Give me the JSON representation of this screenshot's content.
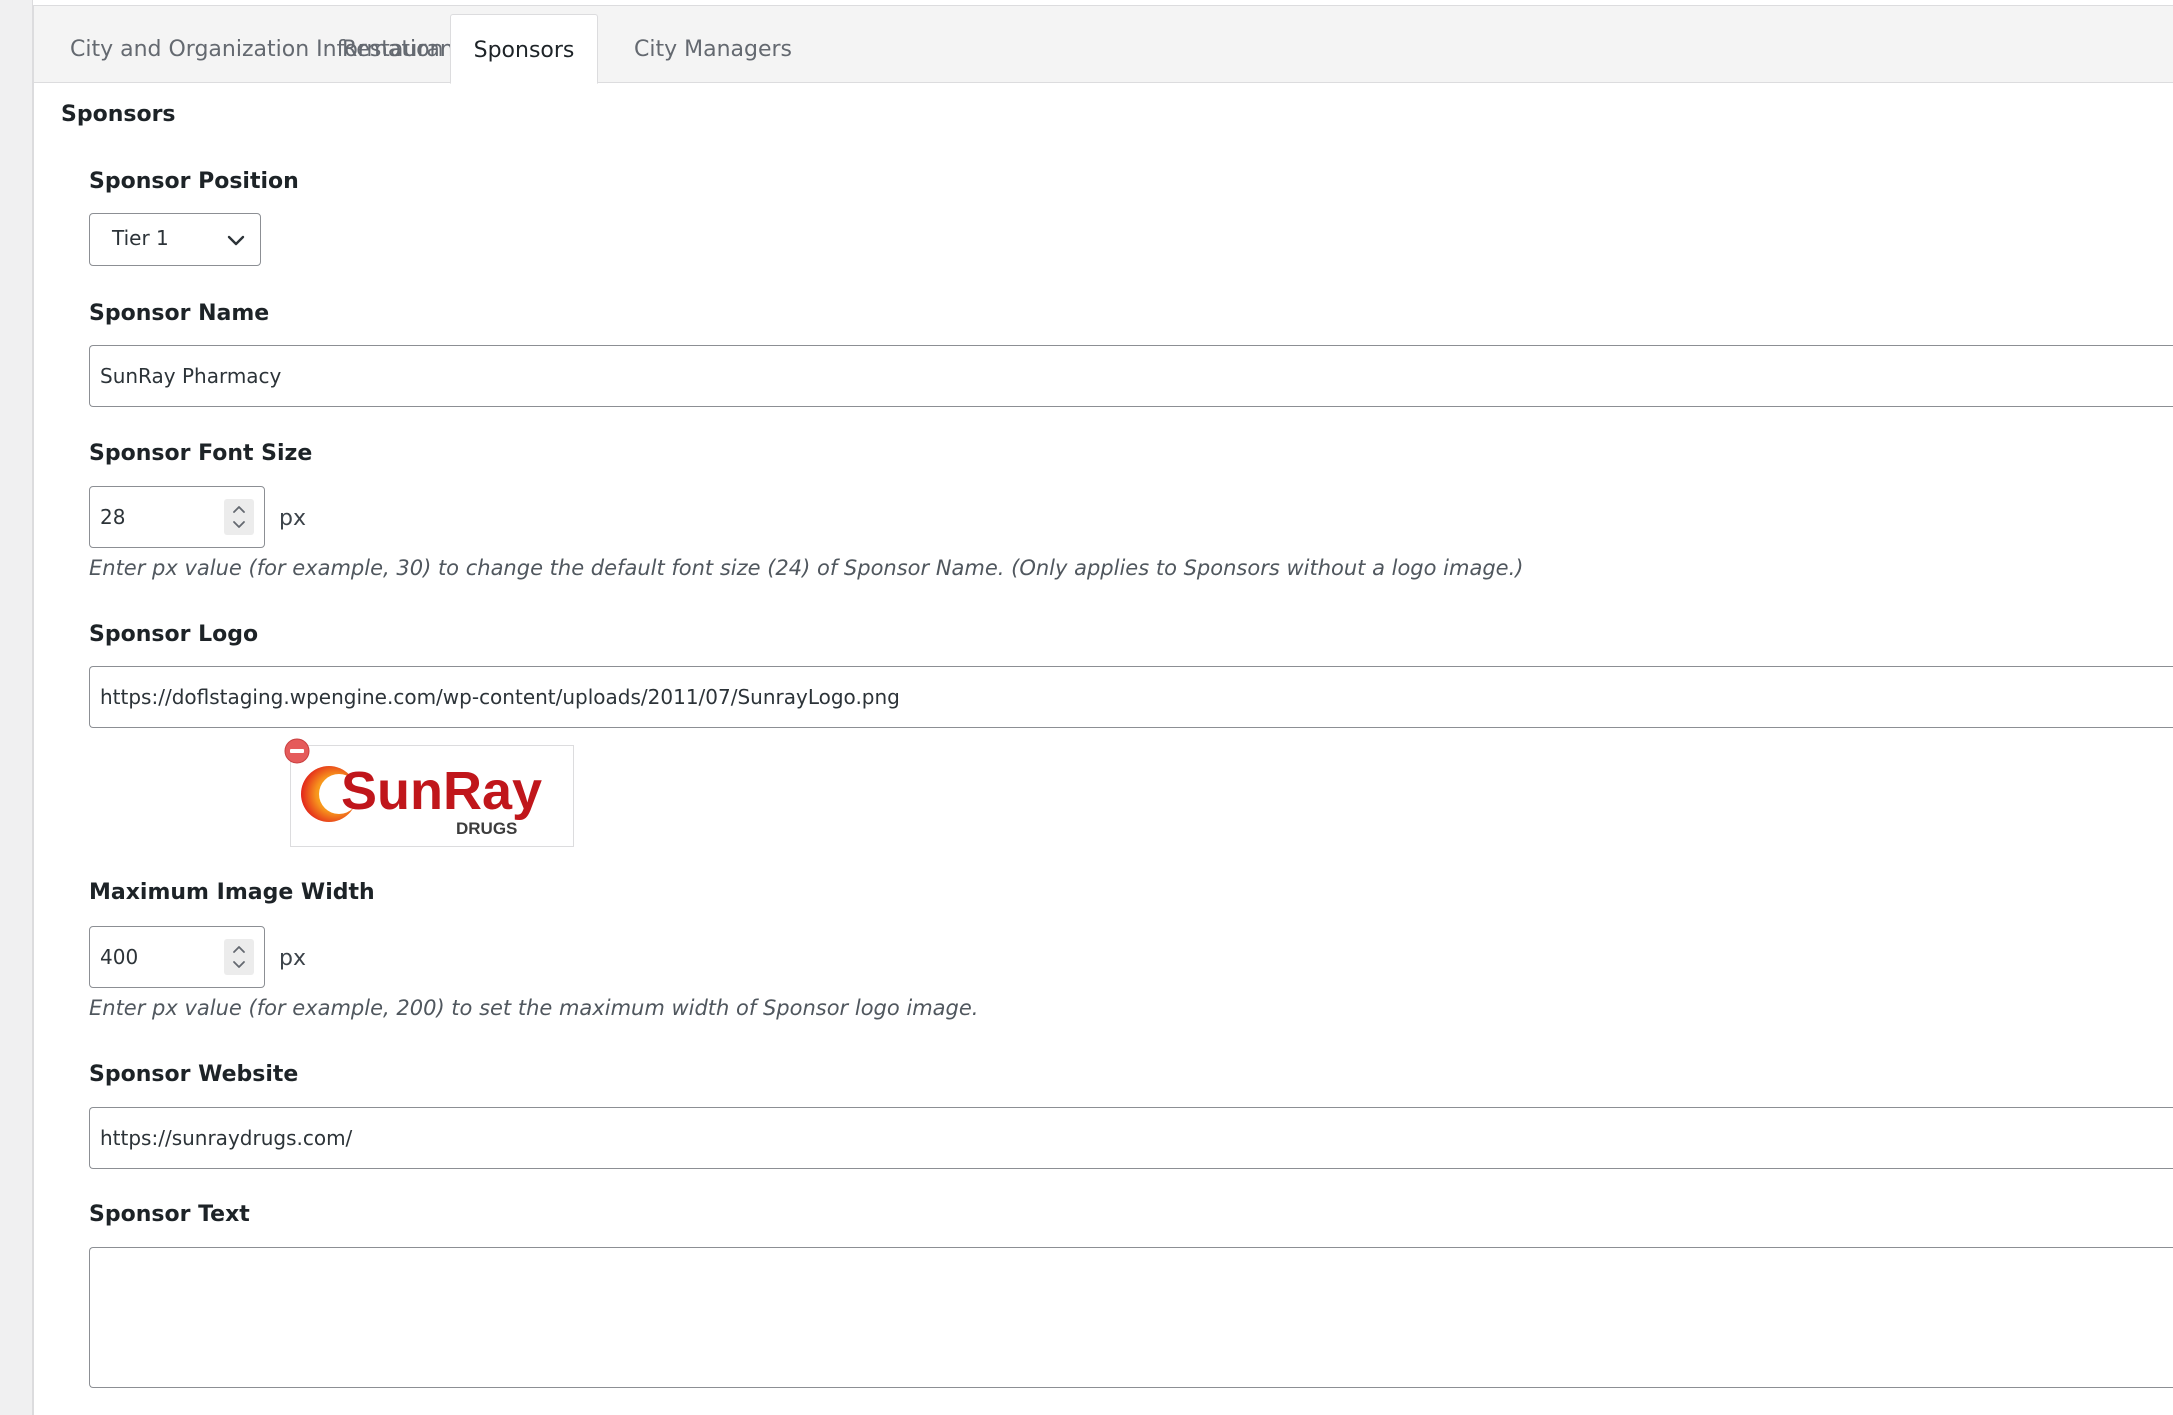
{
  "tabs": [
    {
      "label": "City and Organization Information",
      "active": false
    },
    {
      "label": "Restaurants",
      "active": false
    },
    {
      "label": "Sponsors",
      "active": true
    },
    {
      "label": "City Managers",
      "active": false
    }
  ],
  "section": {
    "title": "Sponsors"
  },
  "sponsor_position": {
    "label": "Sponsor Position",
    "value": "Tier 1",
    "icon": "chevron-down-icon"
  },
  "sponsor_name": {
    "label": "Sponsor Name",
    "value": "SunRay Pharmacy"
  },
  "sponsor_font_size": {
    "label": "Sponsor Font Size",
    "value": "28",
    "unit": "px",
    "hint": "Enter px value (for example, 30) to change the default font size (24) of Sponsor Name. (Only applies to Sponsors without a logo image.)"
  },
  "sponsor_logo": {
    "label": "Sponsor Logo",
    "value": "https://doflstaging.wpengine.com/wp-content/uploads/2011/07/SunrayLogo.png",
    "logo_text": "SunRay",
    "logo_subtext": "DRUGS",
    "remove_icon": "remove-circle-icon",
    "colors": {
      "logo_red": "#c0161b",
      "logo_orange": "#f7941d",
      "remove": "#e55b5b"
    }
  },
  "max_image_width": {
    "label": "Maximum Image Width",
    "value": "400",
    "unit": "px",
    "hint": "Enter px value (for example, 200) to set the maximum width of Sponsor logo image."
  },
  "sponsor_website": {
    "label": "Sponsor Website",
    "value": "https://sunraydrugs.com/"
  },
  "sponsor_text": {
    "label": "Sponsor Text",
    "value": ""
  }
}
